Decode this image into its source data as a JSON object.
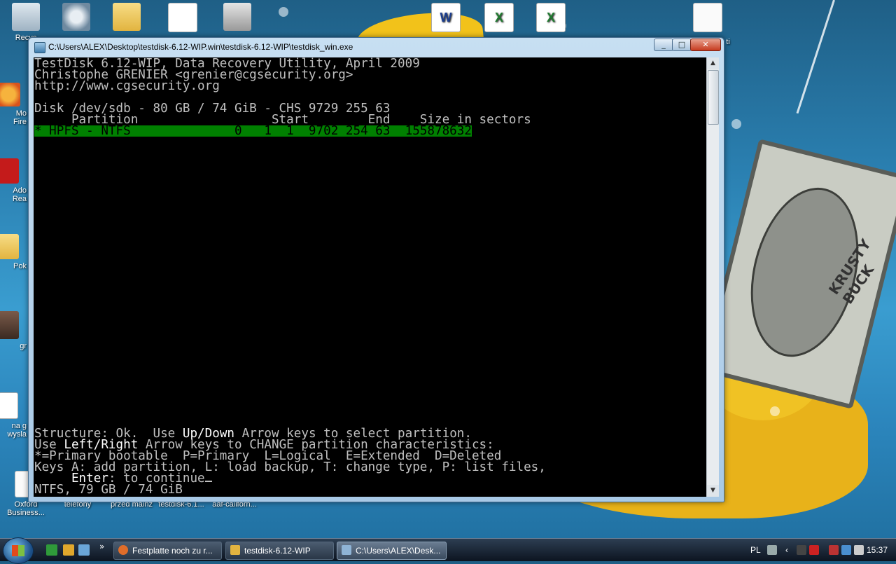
{
  "desktop": {
    "icons": [
      {
        "label": "Recyc",
        "icon": "recycle-bin-icon"
      },
      {
        "label": "",
        "icon": "web-icon"
      },
      {
        "label": "",
        "icon": "folder-icon"
      },
      {
        "label": "",
        "icon": "pdf-document-icon"
      },
      {
        "label": "",
        "icon": "settings-program-icon"
      },
      {
        "label": "",
        "icon": "word-document-icon"
      },
      {
        "label": "",
        "icon": "excel-spreadsheet-icon"
      },
      {
        "label": "",
        "icon": "excel-spreadsheet-icon"
      },
      {
        "label": "ti",
        "icon": "document-icon"
      },
      {
        "label": "Mo\nFire",
        "icon": "firefox-icon"
      },
      {
        "label": "Ado\nRea",
        "icon": "adobe-reader-icon"
      },
      {
        "label": "Pok",
        "icon": "folder-icon"
      },
      {
        "label": "gr",
        "icon": "photo-icon"
      },
      {
        "label": "na g\nwysla",
        "icon": "word-document-icon"
      },
      {
        "label": "Oxford\nBusiness...",
        "icon": "oxford-dictionary-icon"
      },
      {
        "label": "telefony",
        "icon": "folder-icon"
      },
      {
        "label": "przed mainz",
        "icon": "folder-icon"
      },
      {
        "label": "testdisk-6.1...",
        "icon": "folder-icon"
      },
      {
        "label": "aaf-californ...",
        "icon": "document-icon"
      }
    ],
    "wallpaper_text": "KRUSTY BUCK"
  },
  "window": {
    "title": "C:\\Users\\ALEX\\Desktop\\testdisk-6.12-WIP.win\\testdisk-6.12-WIP\\testdisk_win.exe",
    "buttons": {
      "minimize": "_",
      "maximize": "□",
      "close": "✕"
    }
  },
  "console": {
    "line1": "TestDisk 6.12-WIP, Data Recovery Utility, April 2009",
    "line2": "Christophe GRENIER <grenier@cgsecurity.org>",
    "line3": "http://www.cgsecurity.org",
    "disk": "Disk /dev/sdb - 80 GB / 74 GiB - CHS 9729 255 63",
    "header": "     Partition                  Start        End    Size in sectors",
    "partition_row": "* HPFS - NTFS              0   1  1  9702 254 63  155878632",
    "help1_a": "Structure: Ok.  Use ",
    "help1_b": "Up/Down",
    "help1_c": " Arrow keys to select partition.",
    "help2_a": "Use ",
    "help2_b": "Left/Right",
    "help2_c": " Arrow keys to CHANGE partition characteristics:",
    "help3": "*=Primary bootable  P=Primary  L=Logical  E=Extended  D=Deleted",
    "help4": "Keys A: add partition, L: load backup, T: change type, P: list files,",
    "help5_a": "     ",
    "help5_b": "Enter",
    "help5_c": ": to continue",
    "status": "NTFS, 79 GB / 74 GiB"
  },
  "taskbar": {
    "tasks": [
      {
        "label": "Festplatte noch zu r...",
        "icon": "firefox-icon"
      },
      {
        "label": "testdisk-6.12-WIP",
        "icon": "folder-icon"
      },
      {
        "label": "C:\\Users\\ALEX\\Desk...",
        "icon": "console-icon"
      }
    ],
    "language": "PL",
    "clock": "15:37"
  },
  "colors": {
    "console_bg": "#000000",
    "console_fg": "#c0c0c0",
    "highlight": "#008000"
  }
}
